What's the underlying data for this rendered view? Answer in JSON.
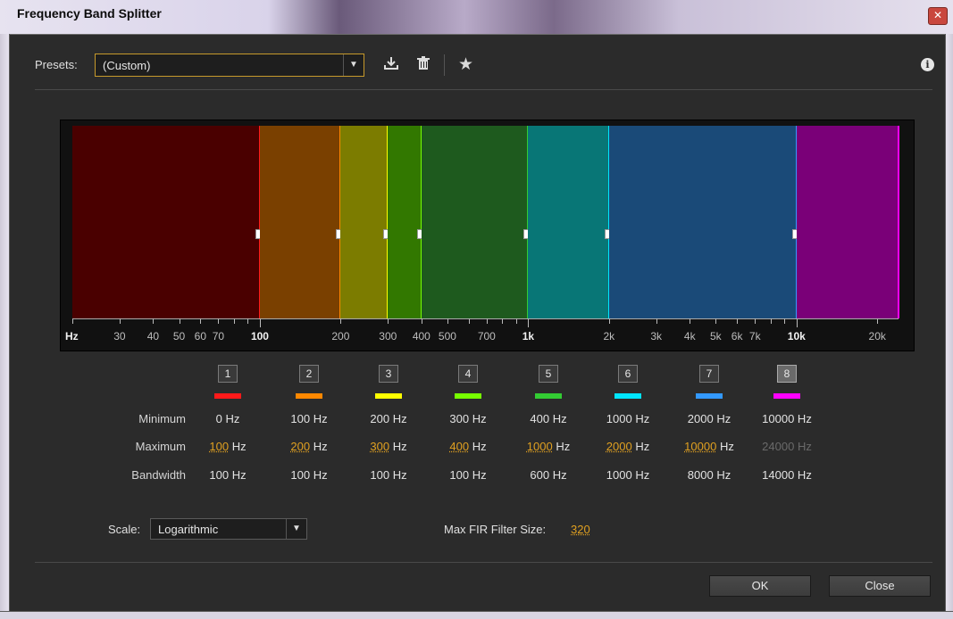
{
  "window": {
    "title": "Frequency Band Splitter",
    "close_glyph": "✕"
  },
  "presets": {
    "label": "Presets:",
    "value": "(Custom)"
  },
  "toolbar": {
    "icons": [
      "save-preset-icon",
      "delete-preset-icon",
      "favorite-star-icon",
      "info-icon"
    ]
  },
  "graph": {
    "scale": "logarithmic",
    "min_hz": 20,
    "max_hz": 24000,
    "band_colors_fill": [
      "#4a0000",
      "#7a4000",
      "#7c7c00",
      "#327800",
      "#1e5a1e",
      "#087676",
      "#1a4a78",
      "#7a0078"
    ],
    "band_colors_line": [
      "#ff1a1a",
      "#ff8800",
      "#ffff00",
      "#77ff00",
      "#33cc33",
      "#00e5ff",
      "#3399ff",
      "#ff00ff"
    ],
    "axis_labels": [
      {
        "hz": 20,
        "text": "Hz",
        "major": true
      },
      {
        "hz": 30,
        "text": "30"
      },
      {
        "hz": 40,
        "text": "40"
      },
      {
        "hz": 50,
        "text": "50"
      },
      {
        "hz": 60,
        "text": "60"
      },
      {
        "hz": 70,
        "text": "70"
      },
      {
        "hz": 100,
        "text": "100",
        "major": true
      },
      {
        "hz": 200,
        "text": "200"
      },
      {
        "hz": 300,
        "text": "300"
      },
      {
        "hz": 400,
        "text": "400"
      },
      {
        "hz": 500,
        "text": "500"
      },
      {
        "hz": 700,
        "text": "700"
      },
      {
        "hz": 1000,
        "text": "1k",
        "major": true
      },
      {
        "hz": 2000,
        "text": "2k"
      },
      {
        "hz": 3000,
        "text": "3k"
      },
      {
        "hz": 4000,
        "text": "4k"
      },
      {
        "hz": 5000,
        "text": "5k"
      },
      {
        "hz": 6000,
        "text": "6k"
      },
      {
        "hz": 7000,
        "text": "7k"
      },
      {
        "hz": 10000,
        "text": "10k",
        "major": true
      },
      {
        "hz": 20000,
        "text": "20k"
      }
    ]
  },
  "bands": [
    {
      "num": "1",
      "min": "0 Hz",
      "max_val": "100",
      "max_unit": " Hz",
      "bw": "100 Hz"
    },
    {
      "num": "2",
      "min": "100 Hz",
      "max_val": "200",
      "max_unit": " Hz",
      "bw": "100 Hz"
    },
    {
      "num": "3",
      "min": "200 Hz",
      "max_val": "300",
      "max_unit": " Hz",
      "bw": "100 Hz"
    },
    {
      "num": "4",
      "min": "300 Hz",
      "max_val": "400",
      "max_unit": " Hz",
      "bw": "100 Hz"
    },
    {
      "num": "5",
      "min": "400 Hz",
      "max_val": "1000",
      "max_unit": " Hz",
      "bw": "600 Hz"
    },
    {
      "num": "6",
      "min": "1000 Hz",
      "max_val": "2000",
      "max_unit": " Hz",
      "bw": "1000 Hz"
    },
    {
      "num": "7",
      "min": "2000 Hz",
      "max_val": "10000",
      "max_unit": " Hz",
      "bw": "8000 Hz"
    },
    {
      "num": "8",
      "min": "10000 Hz",
      "max_val": "24000",
      "max_unit": " Hz",
      "bw": "14000 Hz",
      "max_disabled": true
    }
  ],
  "table_labels": {
    "minimum": "Minimum",
    "maximum": "Maximum",
    "bandwidth": "Bandwidth"
  },
  "scale": {
    "label": "Scale:",
    "value": "Logarithmic"
  },
  "fir": {
    "label": "Max FIR Filter Size:",
    "value": "320"
  },
  "buttons": {
    "ok": "OK",
    "close": "Close"
  }
}
